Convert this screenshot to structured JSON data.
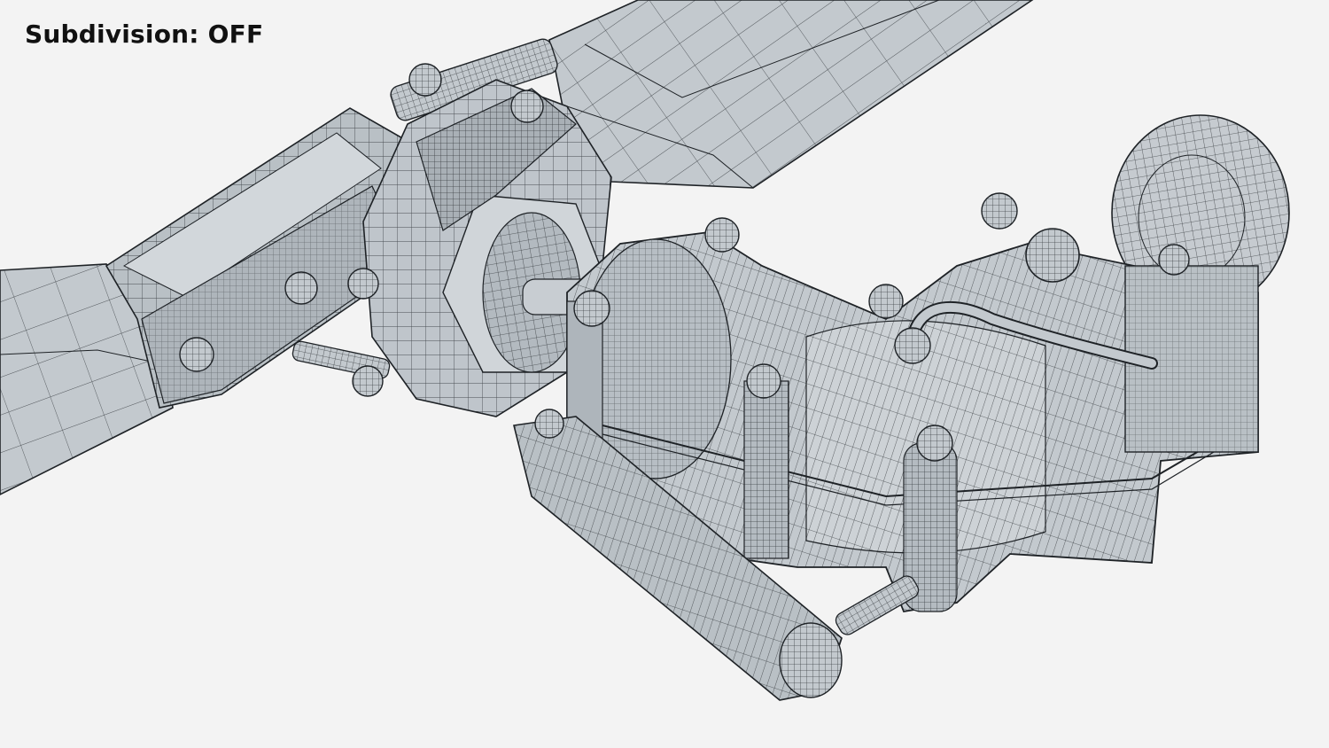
{
  "overlay": {
    "label": "Subdivision: OFF"
  },
  "render": {
    "background": "#f3f3f3",
    "mesh_fill": "#c3c9ce",
    "mesh_shade": "#a9b0b6",
    "mesh_light": "#d5dadd",
    "wire_color": "#1e2226"
  }
}
